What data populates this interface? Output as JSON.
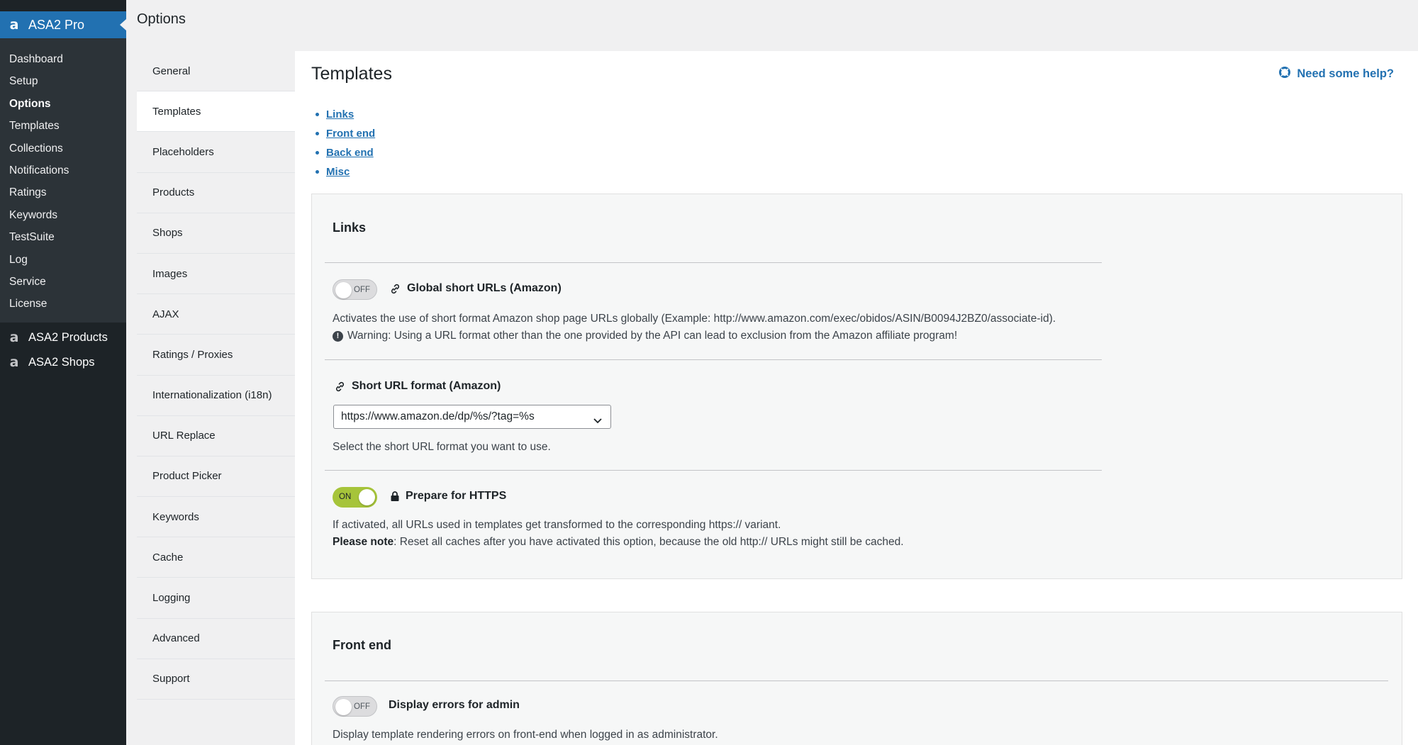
{
  "admin_menu": {
    "plugin_title": "ASA2 Pro",
    "items": [
      {
        "label": "Dashboard",
        "active": false
      },
      {
        "label": "Setup",
        "active": false
      },
      {
        "label": "Options",
        "active": true
      },
      {
        "label": "Templates",
        "active": false
      },
      {
        "label": "Collections",
        "active": false
      },
      {
        "label": "Notifications",
        "active": false
      },
      {
        "label": "Ratings",
        "active": false
      },
      {
        "label": "Keywords",
        "active": false
      },
      {
        "label": "TestSuite",
        "active": false
      },
      {
        "label": "Log",
        "active": false
      },
      {
        "label": "Service",
        "active": false
      },
      {
        "label": "License",
        "active": false
      }
    ],
    "products_label": "ASA2 Products",
    "shops_label": "ASA2 Shops"
  },
  "page": {
    "title": "Options"
  },
  "tabs": [
    {
      "label": "General",
      "active": false
    },
    {
      "label": "Templates",
      "active": true
    },
    {
      "label": "Placeholders",
      "active": false
    },
    {
      "label": "Products",
      "active": false
    },
    {
      "label": "Shops",
      "active": false
    },
    {
      "label": "Images",
      "active": false
    },
    {
      "label": "AJAX",
      "active": false
    },
    {
      "label": "Ratings / Proxies",
      "active": false
    },
    {
      "label": "Internationalization (i18n)",
      "active": false
    },
    {
      "label": "URL Replace",
      "active": false
    },
    {
      "label": "Product Picker",
      "active": false
    },
    {
      "label": "Keywords",
      "active": false
    },
    {
      "label": "Cache",
      "active": false
    },
    {
      "label": "Logging",
      "active": false
    },
    {
      "label": "Advanced",
      "active": false
    },
    {
      "label": "Support",
      "active": false
    }
  ],
  "main": {
    "title": "Templates",
    "help_label": "Need some help?",
    "toc": [
      "Links",
      "Front end",
      "Back end",
      "Misc"
    ],
    "links_section": {
      "heading": "Links",
      "global_short_urls": {
        "toggle_label": "OFF",
        "enabled": false,
        "title": "Global short URLs (Amazon)",
        "description": "Activates the use of short format Amazon shop page URLs globally (Example: http://www.amazon.com/exec/obidos/ASIN/B0094J2BZ0/associate-id).",
        "warning_icon": "!",
        "warning": "Warning: Using a URL format other than the one provided by the API can lead to exclusion from the Amazon affiliate program!"
      },
      "short_url_format": {
        "title": "Short URL format (Amazon)",
        "selected": "https://www.amazon.de/dp/%s/?tag=%s",
        "description": "Select the short URL format you want to use."
      },
      "prepare_https": {
        "toggle_label": "ON",
        "enabled": true,
        "title": "Prepare for HTTPS",
        "description": "If activated, all URLs used in templates get transformed to the corresponding https:// variant.",
        "note_label": "Please note",
        "note_text": ": Reset all caches after you have activated this option, because the old http:// URLs might still be cached."
      }
    },
    "frontend_section": {
      "heading": "Front end",
      "display_errors": {
        "toggle_label": "OFF",
        "enabled": false,
        "title": "Display errors for admin",
        "description": "Display template rendering errors on front-end when logged in as administrator."
      }
    }
  },
  "colors": {
    "sidebar_bg": "#1d2327",
    "submenu_bg": "#2c3338",
    "accent": "#2271b1",
    "toggle_on": "#a6c43a"
  }
}
